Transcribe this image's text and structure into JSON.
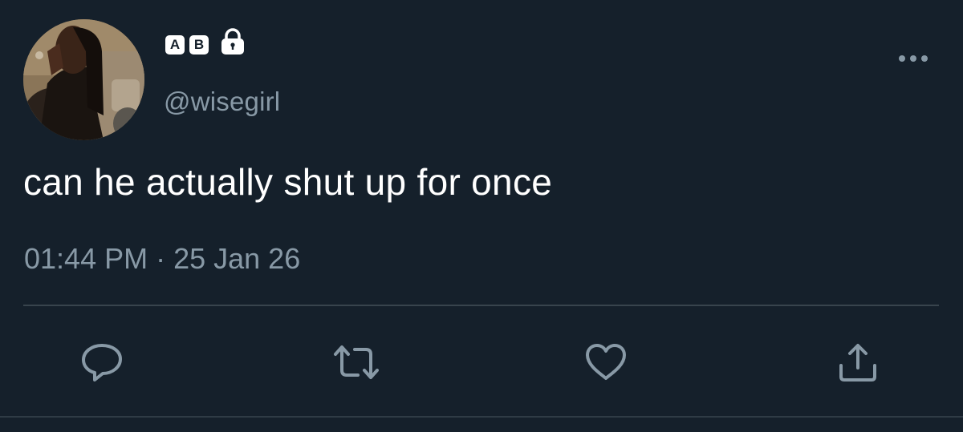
{
  "tweet": {
    "name_badges": [
      "A",
      "B"
    ],
    "handle": "@wisegirl",
    "text": "can he actually shut up for once",
    "timestamp": "01:44 PM · 25 Jan 26"
  },
  "icons": {
    "lock": "lock-icon",
    "more": "more-horizontal-icon",
    "reply": "reply-icon",
    "retweet": "retweet-icon",
    "like": "heart-icon",
    "share": "share-icon"
  },
  "colors": {
    "background": "#15202b",
    "text_primary": "#ffffff",
    "text_secondary": "#8899a6",
    "divider": "#38444d",
    "icon": "#8899a6"
  }
}
